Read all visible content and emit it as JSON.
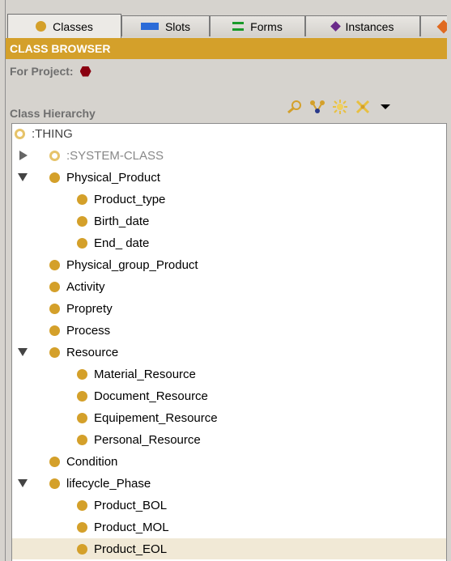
{
  "tabs": [
    {
      "label": "Classes",
      "icon": "class-icon",
      "active": true
    },
    {
      "label": "Slots",
      "icon": "slot-icon",
      "active": false
    },
    {
      "label": "Forms",
      "icon": "form-icon",
      "active": false
    },
    {
      "label": "Instances",
      "icon": "instance-icon",
      "active": false
    }
  ],
  "browser": {
    "title": "CLASS BROWSER",
    "project_label": "For Project:",
    "hierarchy_label": "Class Hierarchy",
    "toolbar": [
      "find-class-icon",
      "add-subclass-icon",
      "add-superclass-icon",
      "delete-class-icon",
      "dropdown-arrow-icon"
    ]
  },
  "tree": [
    {
      "label": ":THING",
      "depth": 0,
      "twisty": "none",
      "meta": true
    },
    {
      "label": ":SYSTEM-CLASS",
      "depth": 1,
      "twisty": "closed",
      "meta": true
    },
    {
      "label": "Physical_Product",
      "depth": 1,
      "twisty": "open"
    },
    {
      "label": "Product_type",
      "depth": 2,
      "twisty": "none"
    },
    {
      "label": "Birth_date",
      "depth": 2,
      "twisty": "none"
    },
    {
      "label": "End_ date",
      "depth": 2,
      "twisty": "none"
    },
    {
      "label": "Physical_group_Product",
      "depth": 1,
      "twisty": "none"
    },
    {
      "label": "Activity",
      "depth": 1,
      "twisty": "none"
    },
    {
      "label": "Proprety",
      "depth": 1,
      "twisty": "none"
    },
    {
      "label": "Process",
      "depth": 1,
      "twisty": "none"
    },
    {
      "label": "Resource",
      "depth": 1,
      "twisty": "open"
    },
    {
      "label": "Material_Resource",
      "depth": 2,
      "twisty": "none"
    },
    {
      "label": "Document_Resource",
      "depth": 2,
      "twisty": "none"
    },
    {
      "label": "Equipement_Resource",
      "depth": 2,
      "twisty": "none"
    },
    {
      "label": "Personal_Resource",
      "depth": 2,
      "twisty": "none"
    },
    {
      "label": "Condition",
      "depth": 1,
      "twisty": "none"
    },
    {
      "label": "lifecycle_Phase",
      "depth": 1,
      "twisty": "open"
    },
    {
      "label": "Product_BOL",
      "depth": 2,
      "twisty": "none"
    },
    {
      "label": "Product_MOL",
      "depth": 2,
      "twisty": "none"
    },
    {
      "label": "Product_EOL",
      "depth": 2,
      "twisty": "none",
      "selected": true
    }
  ],
  "colors": {
    "accent": "#d4a02a",
    "header_text": "#ffffff",
    "selection": "#f1e9d6",
    "project_icon": "#8a0010"
  }
}
